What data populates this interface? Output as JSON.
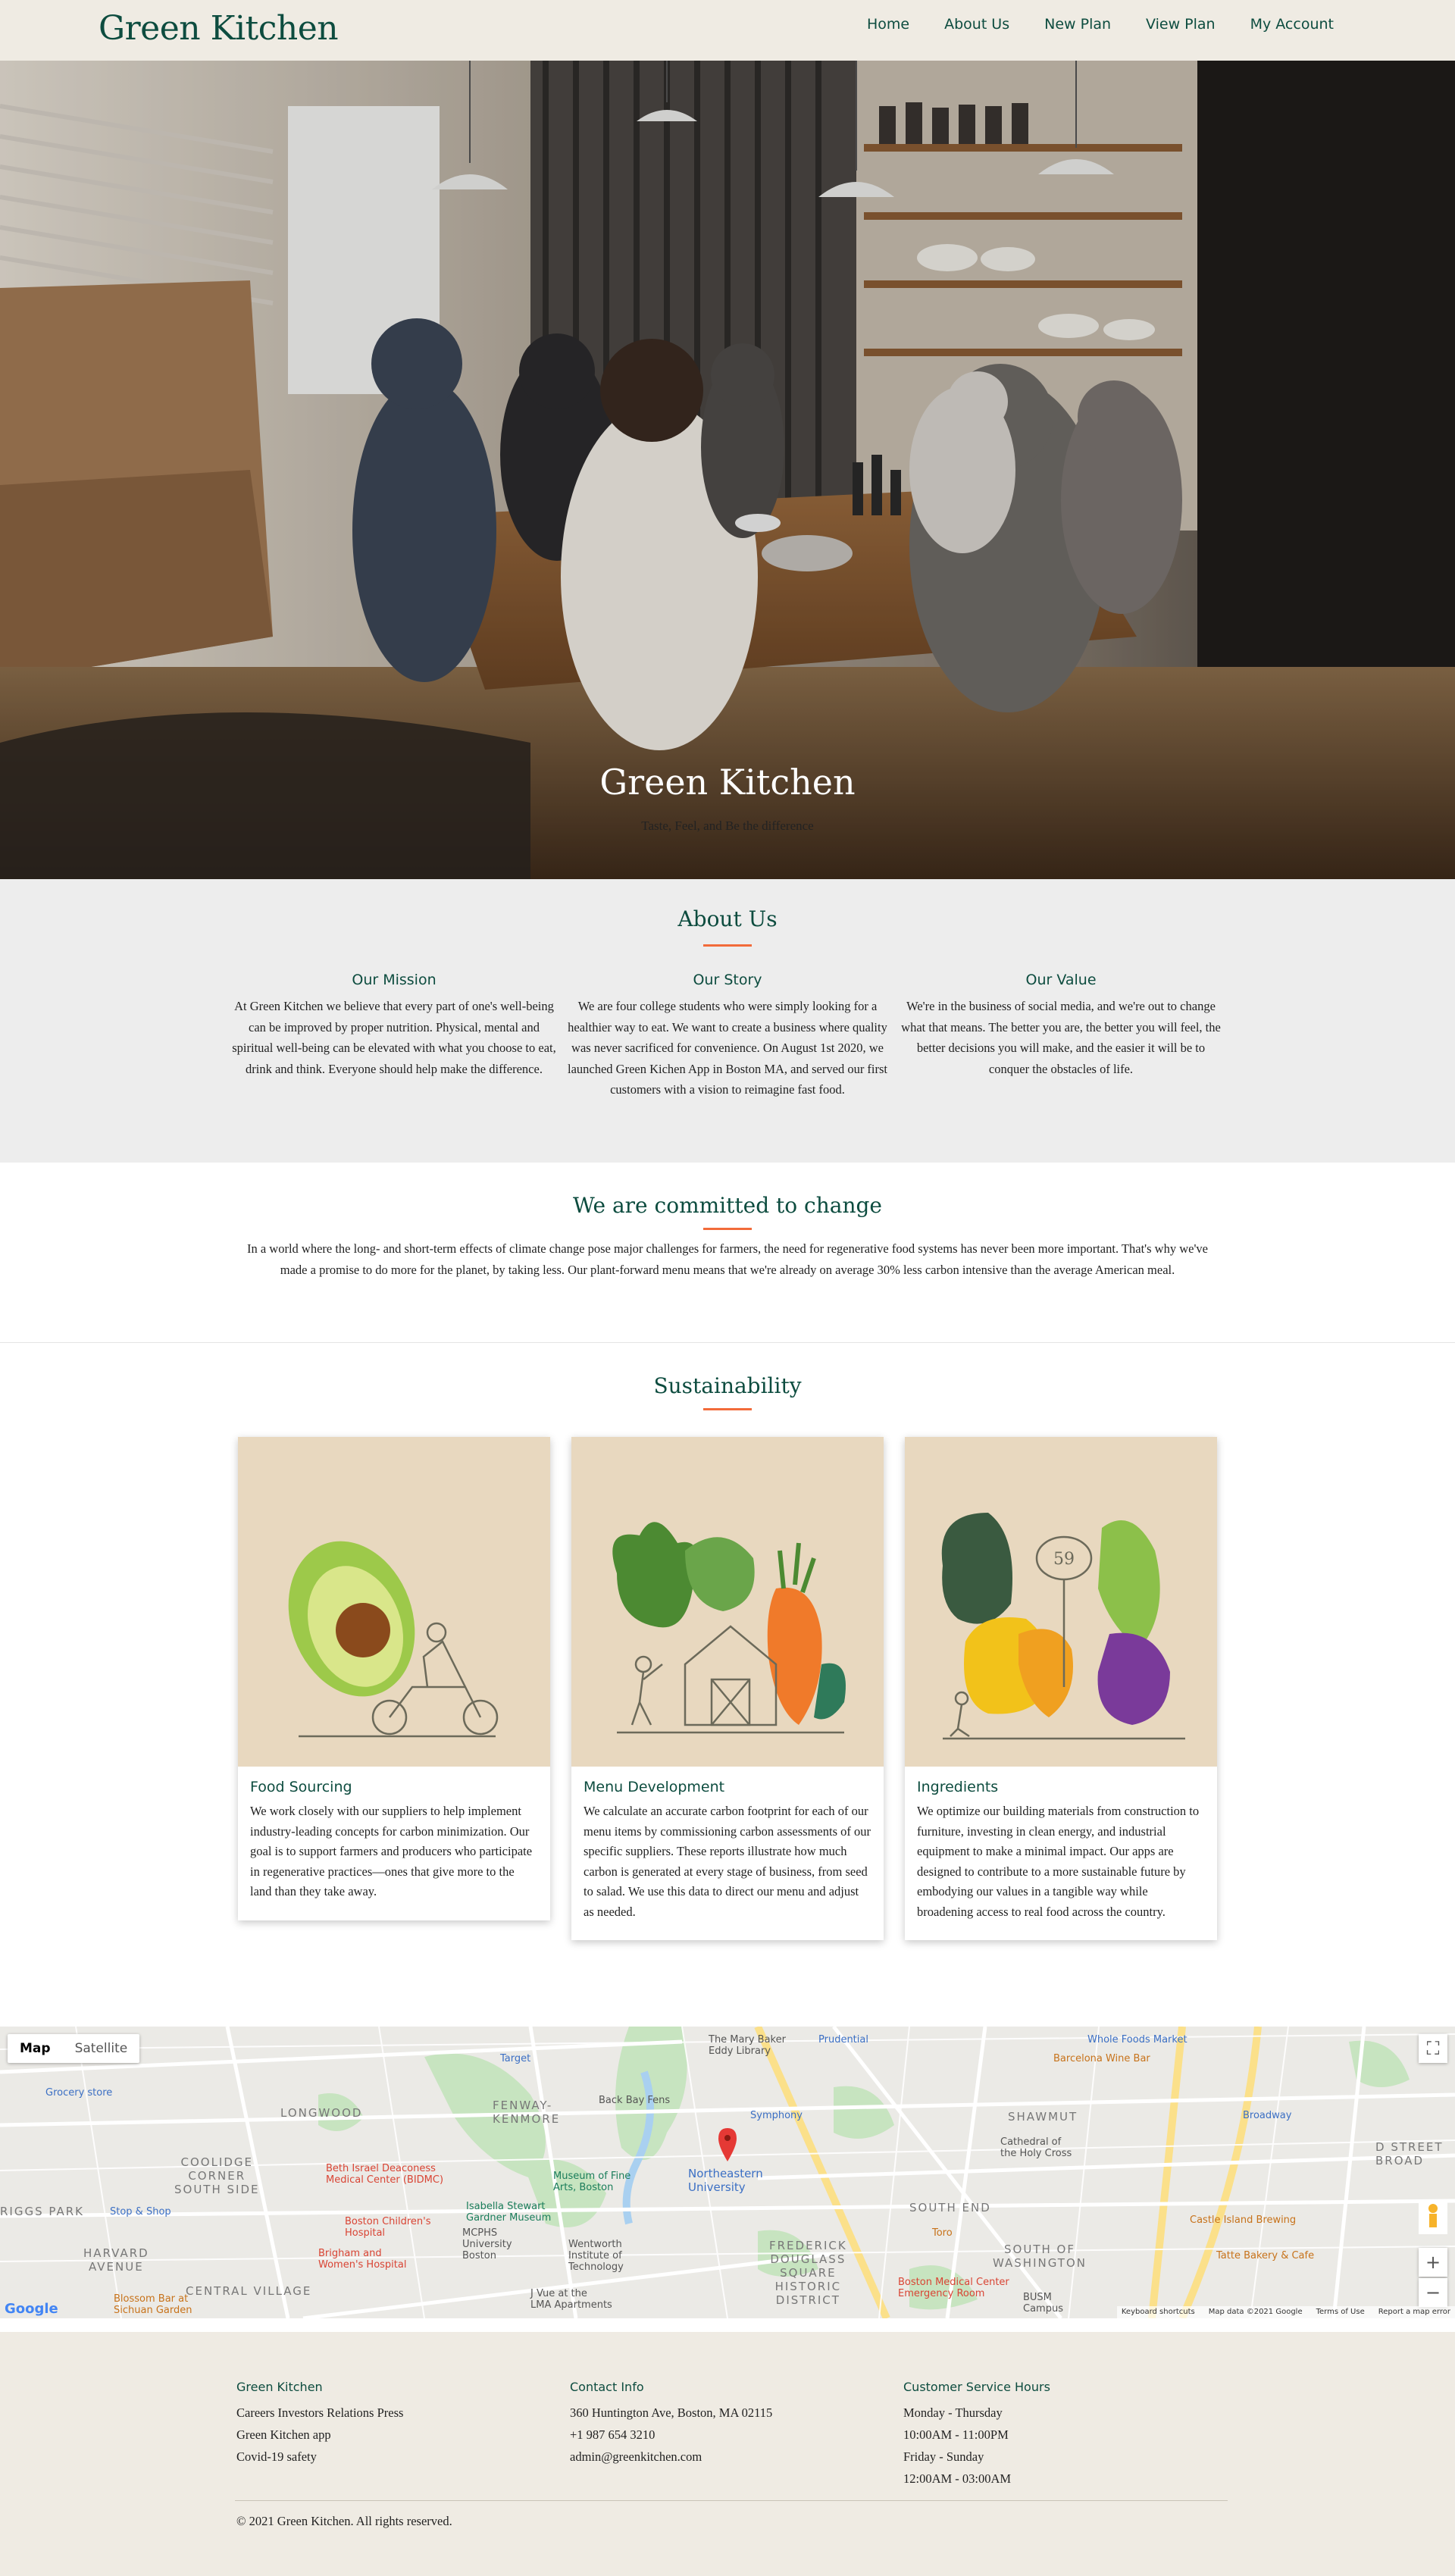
{
  "brand": "Green Kitchen",
  "nav": {
    "items": [
      {
        "label": "Home"
      },
      {
        "label": "About Us"
      },
      {
        "label": "New Plan"
      },
      {
        "label": "View Plan"
      },
      {
        "label": "My Account"
      }
    ]
  },
  "hero": {
    "title": "Green Kitchen",
    "subtitle": "Taste, Feel, and Be the difference"
  },
  "about": {
    "title": "About Us",
    "columns": [
      {
        "heading": "Our Mission",
        "text": "At Green Kitchen we believe that every part of one's well-being can be improved by proper nutrition. Physical, mental and spiritual well-being can be elevated with what you choose to eat, drink and think. Everyone should help make the difference."
      },
      {
        "heading": "Our Story",
        "text": "We are four college students who were simply looking for a healthier way to eat. We want to create a business where quality was never sacrificed for convenience. On August 1st 2020, we launched Green Kichen App in Boston MA, and served our first customers with a vision to reimagine fast food."
      },
      {
        "heading": "Our Value",
        "text": "We're in the business of social media, and we're out to change what that means. The better you are, the better you will feel, the better decisions you will make, and the easier it will be to conquer the obstacles of life."
      }
    ]
  },
  "commit": {
    "title": "We are committed to change",
    "text": "In a world where the long- and short-term effects of climate change pose major challenges for farmers, the need for regenerative food systems has never been more important. That's why we've made a promise to do more for the planet, by taking less. Our plant-forward menu means that we're already on average 30% less carbon intensive than the average American meal."
  },
  "sustainability": {
    "title": "Sustainability",
    "cards": [
      {
        "title": "Food Sourcing",
        "text": "We work closely with our suppliers to help implement industry-leading concepts for carbon minimization. Our goal is to support farmers and producers who participate in regenerative practices—ones that give more to the land than they take away."
      },
      {
        "title": "Menu Development",
        "text": "We calculate an accurate carbon footprint for each of our menu items by commissioning carbon assessments of our specific suppliers. These reports illustrate how much carbon is generated at every stage of business, from seed to salad. We use this data to direct our menu and adjust as needed."
      },
      {
        "title": "Ingredients",
        "text": "We optimize our building materials from construction to furniture, investing in clean energy, and industrial equipment to make a minimal impact. Our apps are designed to contribute to a more sustainable future by embodying our values in a tangible way while broadening access to real food across the country."
      }
    ],
    "price_tag": "59"
  },
  "map": {
    "toggle": {
      "map": "Map",
      "satellite": "Satellite"
    },
    "logo": "Google",
    "attribution": [
      "Keyboard shortcuts",
      "Map data ©2021 Google",
      "Terms of Use",
      "Report a map error"
    ],
    "labels": {
      "longwood": "LONGWOOD",
      "fenway": "FENWAY-\nKENMORE",
      "coolidge": "COOLIDGE\nCORNER\nSOUTH SIDE",
      "shawmut": "SHAWMUT",
      "south_end": "SOUTH END",
      "south_washington": "SOUTH OF\nWASHINGTON",
      "harvard": "HARVARD\nAVENUE",
      "central_village": "CENTRAL VILLAGE",
      "frederick": "FREDERICK\nDOUGLASS\nSQUARE\nHISTORIC\nDISTRICT",
      "d_street": "D STREET\nBROAD",
      "riggs": "RIGGS PARK",
      "northeastern": "Northeastern\nUniversity",
      "museum": "Museum of Fine\nArts, Boston",
      "gardner": "Isabella Stewart\nGardner Museum",
      "bidmc": "Beth Israel Deaconess\nMedical Center (BIDMC)",
      "childrens": "Boston Children's\nHospital",
      "brigham": "Brigham and\nWomen's Hospital",
      "bmc": "Boston Medical Center\nEmergency Room",
      "mary_baker": "The Mary Baker\nEddy Library",
      "target": "Target",
      "whole_foods": "Whole Foods Market",
      "barcelona": "Barcelona Wine Bar",
      "castle": "Castle Island Brewing",
      "tatte": "Tatte Bakery & Cafe",
      "symphony": "Symphony",
      "back_bay": "Back Bay Fens",
      "wentworth": "Wentworth\nInstitute of\nTechnology",
      "bush": "BUSM\nCampus",
      "toro": "Toro",
      "cathedral": "Cathedral of\nthe Holy Cross",
      "blossom": "Blossom Bar at\nSichuan Garden",
      "jvue": "J Vue at the\nLMA Apartments",
      "mcphs": "MCPHS\nUniversity\nBoston",
      "stop_shop": "Stop & Shop",
      "grocery": "Grocery store",
      "prudential": "Prudential",
      "broadway": "Broadway"
    }
  },
  "footer": {
    "cols": [
      {
        "heading": "Green Kitchen",
        "lines": [
          "Careers Investors Relations Press",
          "Green Kitchen app",
          "Covid-19 safety"
        ]
      },
      {
        "heading": "Contact Info",
        "lines": [
          "360 Huntington Ave, Boston, MA 02115",
          "+1 987 654 3210",
          "admin@greenkitchen.com"
        ]
      },
      {
        "heading": "Customer Service Hours",
        "lines": [
          "Monday - Thursday",
          "10:00AM - 11:00PM",
          "Friday - Sunday",
          "12:00AM - 03:00AM"
        ]
      }
    ],
    "copyright": "© 2021 Green Kitchen. All rights reserved."
  }
}
